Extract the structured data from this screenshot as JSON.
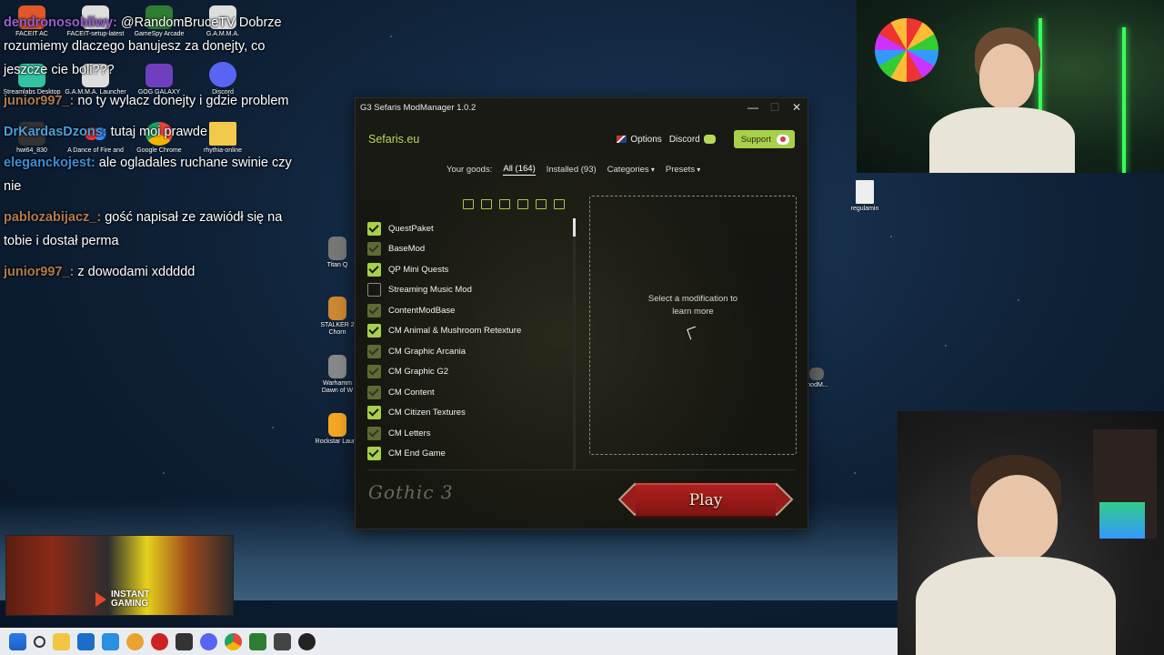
{
  "chat": [
    {
      "user": "dendronosobliwy:",
      "user_color": "#9a5fd0",
      "message": "@RandomBruceTV Dobrze rozumiemy dlaczego banujesz za donejty, co jeszcze cie boli???"
    },
    {
      "user": "junior997_:",
      "user_color": "#b07a4c",
      "message": "no ty wylacz donejty i gdzie problem"
    },
    {
      "user": "DrKardasDzons:",
      "user_color": "#4d9ed8",
      "message": "tutaj moi prawde"
    },
    {
      "user": "eleganckojest:",
      "user_color": "#3a8fd8",
      "message": "ale ogladales ruchane swinie czy nie"
    },
    {
      "user": "pablozabijacz_:",
      "user_color": "#b07a4c",
      "message": "gość napisał ze zawiódł się na tobie i dostał perma"
    },
    {
      "user": "junior997_:",
      "user_color": "#b07a4c",
      "message": "z dowodami xddddd"
    }
  ],
  "desktop_icons": [
    {
      "label": "FACEIT AC",
      "color": "#e0572a"
    },
    {
      "label": "FACEIT-setup-latest",
      "color": "#ddd"
    },
    {
      "label": "GameSpy Arcade",
      "color": "#2f7d32"
    },
    {
      "label": "G.A.M.M.A.",
      "color": "#ddd"
    },
    {
      "label": "Streamlabs Desktop",
      "color": "#31c3a2"
    },
    {
      "label": "G.A.M.M.A. Launcher",
      "color": "#ddd"
    },
    {
      "label": "GOG GALAXY",
      "color": "#6f3fc0"
    },
    {
      "label": "Discord",
      "color": "#5865f2"
    },
    {
      "label": "hwi64_830",
      "color": "#333"
    },
    {
      "label": "A Dance of Fire and",
      "color": "#d33"
    },
    {
      "label": "Google Chrome",
      "color": "#e8453c"
    },
    {
      "label": "rhythia-online",
      "color": "#f2c94c"
    },
    {
      "label": "regulamin",
      "color": "#eee"
    },
    {
      "label": "Titan Q",
      "color": "#777"
    },
    {
      "label": "STALKER 2 Chorn",
      "color": "#c83"
    },
    {
      "label": "Warhamm Dawn of W",
      "color": "#888"
    },
    {
      "label": "Rockstar Launc",
      "color": "#f5a623"
    },
    {
      "label": "modM...",
      "color": "#666"
    }
  ],
  "window": {
    "title": "G3 Sefaris ModManager 1.0.2",
    "minimize_label": "—",
    "maximize_label": "☐",
    "close_label": "✕",
    "brand": "Sefaris.eu",
    "options_label": "Options",
    "discord_label": "Discord",
    "support_label": "Support",
    "your_goods_label": "Your goods:",
    "tab_all": "All (164)",
    "tab_installed": "Installed (93)",
    "categories_label": "Categories",
    "presets_label": "Presets",
    "detail_message": "Select a modification to learn more",
    "logo_text": "Gothic 3",
    "play_label": "Play",
    "accent_color": "#a8d04a"
  },
  "mods": [
    {
      "name": "QuestPaket",
      "state": "on"
    },
    {
      "name": "BaseMod",
      "state": "dim"
    },
    {
      "name": "QP Mini Quests",
      "state": "on"
    },
    {
      "name": "Streaming Music Mod",
      "state": "off"
    },
    {
      "name": "ContentModBase",
      "state": "dim"
    },
    {
      "name": "CM Animal & Mushroom Retexture",
      "state": "on"
    },
    {
      "name": "CM Graphic Arcania",
      "state": "dim"
    },
    {
      "name": "CM Graphic G2",
      "state": "dim"
    },
    {
      "name": "CM Content",
      "state": "dim"
    },
    {
      "name": "CM Citizen Textures",
      "state": "on"
    },
    {
      "name": "CM Letters",
      "state": "dim"
    },
    {
      "name": "CM End Game",
      "state": "on"
    }
  ],
  "ad": {
    "label_line1": "INSTANT",
    "label_line2": "GAMING"
  },
  "taskbar_icons": [
    "windows-start",
    "search",
    "file-explorer",
    "store",
    "app",
    "app",
    "app",
    "app",
    "discord",
    "chrome",
    "app",
    "gamma",
    "app"
  ]
}
